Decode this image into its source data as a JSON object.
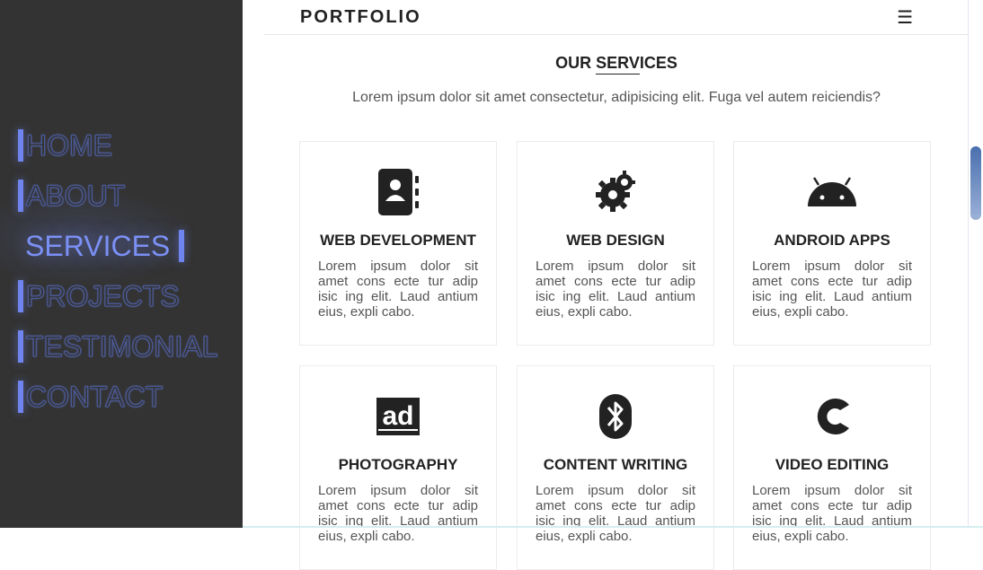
{
  "sidebar": {
    "items": [
      {
        "label": "HOME",
        "active": false
      },
      {
        "label": "ABOUT",
        "active": false
      },
      {
        "label": "SERVICES",
        "active": true
      },
      {
        "label": "PROJECTS",
        "active": false
      },
      {
        "label": "TESTIMONIAL",
        "active": false
      },
      {
        "label": "CONTACT",
        "active": false
      }
    ]
  },
  "header": {
    "brand": "PORTFOLIO",
    "menu_icon": "☰"
  },
  "services": {
    "title_before": "OUR ",
    "title_underlined": "SERV",
    "title_after": "ICES",
    "subtitle": "Lorem ipsum dolor sit amet consectetur, adipisicing elit. Fuga vel autem reiciendis?",
    "cards": [
      {
        "icon": "address-book-icon",
        "title": "WEB DEVELOPMENT",
        "desc": "Lorem ipsum dolor sit amet cons ecte tur adip isic ing elit. Laud antium eius, expli cabo."
      },
      {
        "icon": "gears-icon",
        "title": "WEB DESIGN",
        "desc": "Lorem ipsum dolor sit amet cons ecte tur adip isic ing elit. Laud antium eius, expli cabo."
      },
      {
        "icon": "android-icon",
        "title": "ANDROID APPS",
        "desc": "Lorem ipsum dolor sit amet cons ecte tur adip isic ing elit. Laud antium eius, expli cabo."
      },
      {
        "icon": "ad-icon",
        "title": "PHOTOGRAPHY",
        "desc": "Lorem ipsum dolor sit amet cons ecte tur adip isic ing elit. Laud antium eius, expli cabo."
      },
      {
        "icon": "bluetooth-icon",
        "title": "CONTENT WRITING",
        "desc": "Lorem ipsum dolor sit amet cons ecte tur adip isic ing elit. Laud antium eius, expli cabo."
      },
      {
        "icon": "c-logo-icon",
        "title": "VIDEO EDITING",
        "desc": "Lorem ipsum dolor sit amet cons ecte tur adip isic ing elit. Laud antium eius, expli cabo."
      }
    ]
  },
  "colors": {
    "sidebar_bg": "#333333",
    "accent": "#7b90f5"
  }
}
